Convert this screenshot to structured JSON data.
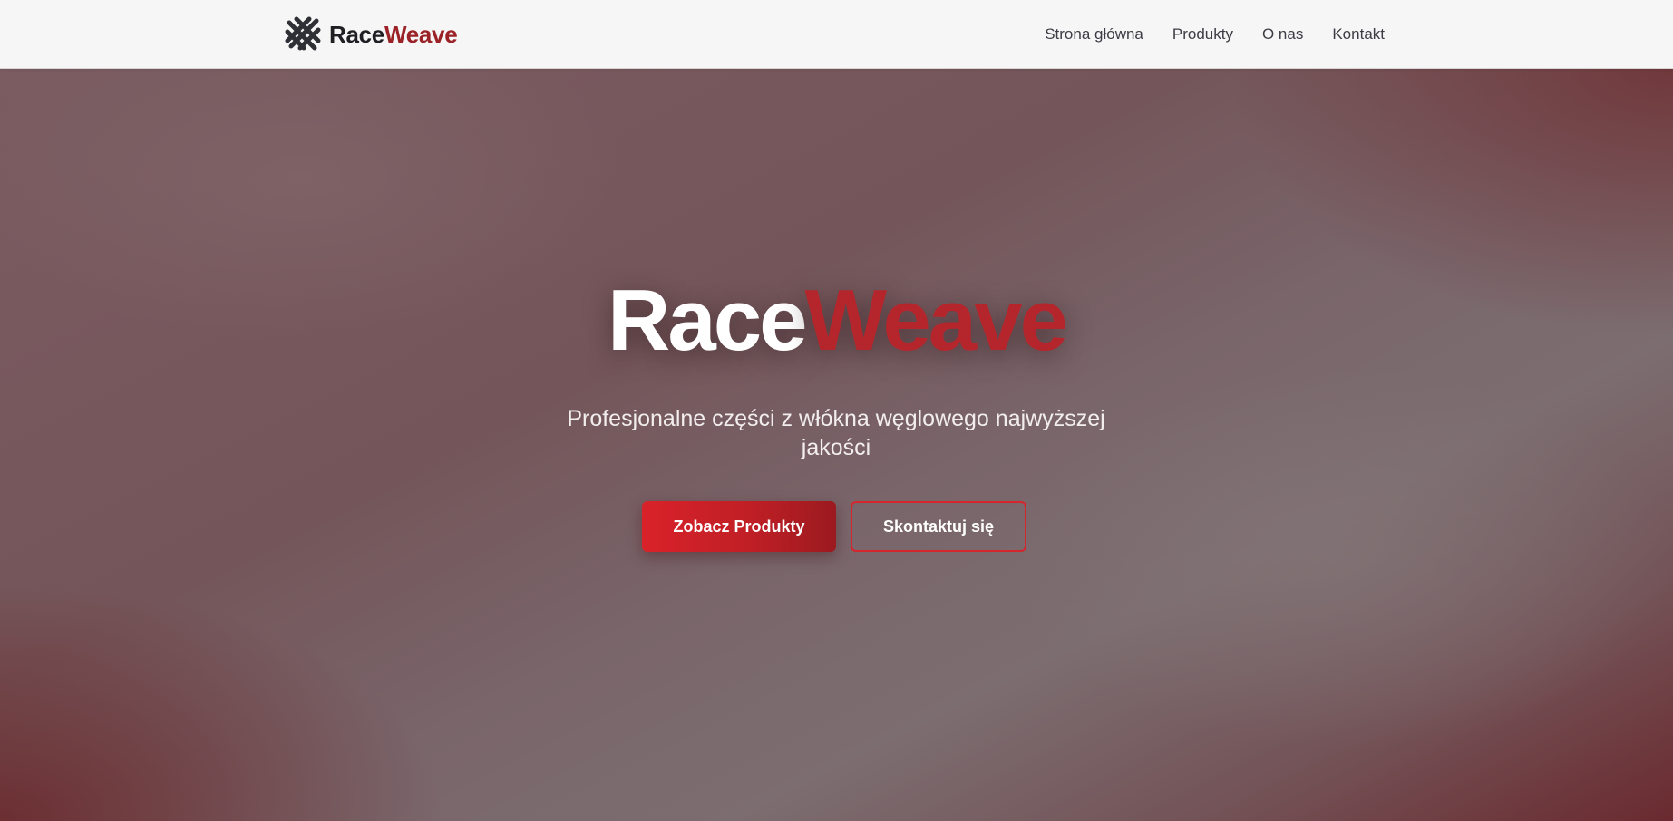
{
  "colors": {
    "brand_dark": "#1f1f24",
    "brand_red": "#9b2226",
    "hero_accent_red": "#b5262c",
    "button_red": "#d92229",
    "nav_background": "#f7f6f6"
  },
  "navbar": {
    "logo_icon": "crossed-weave-icon",
    "brand_part1": "Race",
    "brand_part2": "Weave",
    "links": [
      {
        "label": "Strona główna"
      },
      {
        "label": "Produkty"
      },
      {
        "label": "O nas"
      },
      {
        "label": "Kontakt"
      }
    ]
  },
  "hero": {
    "title_part1": "Race",
    "title_part2": "Weave",
    "subtitle": "Profesjonalne części z włókna węglowego najwyższej jakości",
    "primary_button": "Zobacz Produkty",
    "secondary_button": "Skontaktuj się"
  }
}
